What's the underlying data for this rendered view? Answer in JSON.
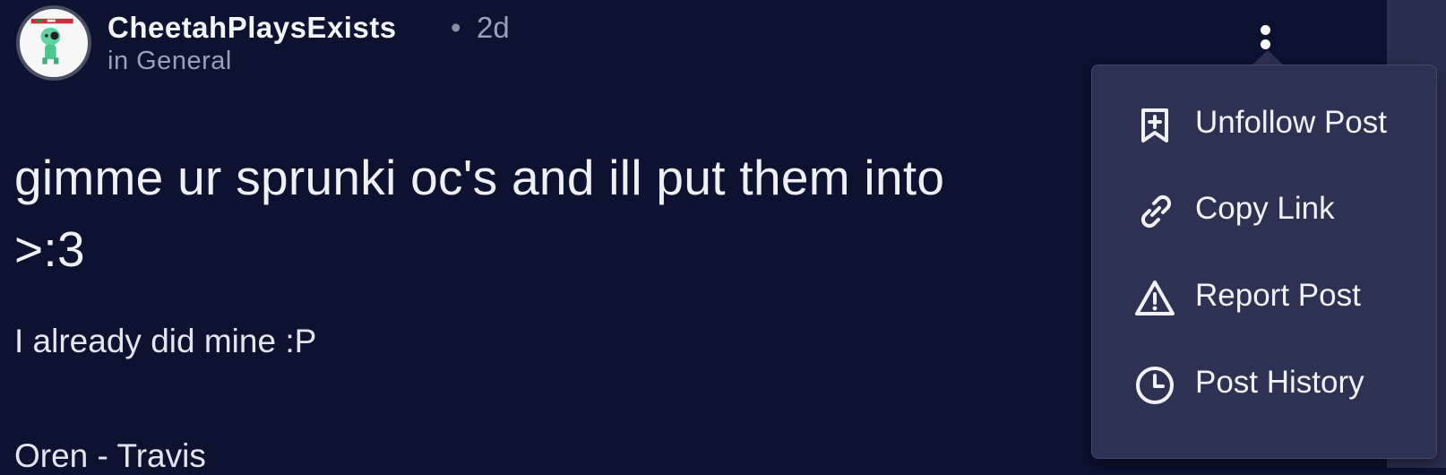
{
  "post": {
    "author": "CheetahPlaysExists",
    "separator": "•",
    "time_ago": "2d",
    "category": "in General",
    "title": "gimme ur sprunki oc's and ill put them into",
    "title_line2": ">:3",
    "body_line1": "I already did mine :P",
    "body_line2": "Oren - Travis"
  },
  "menu": {
    "items": [
      {
        "label": "Unfollow Post",
        "icon": "bookmark-plus-icon"
      },
      {
        "label": "Copy Link",
        "icon": "link-icon"
      },
      {
        "label": "Report Post",
        "icon": "warning-icon"
      },
      {
        "label": "Post History",
        "icon": "clock-icon"
      }
    ]
  },
  "colors": {
    "background": "#0c1230",
    "menu_background": "#2e3252",
    "text": "#eceef5",
    "muted_text": "#9aa0b6"
  }
}
